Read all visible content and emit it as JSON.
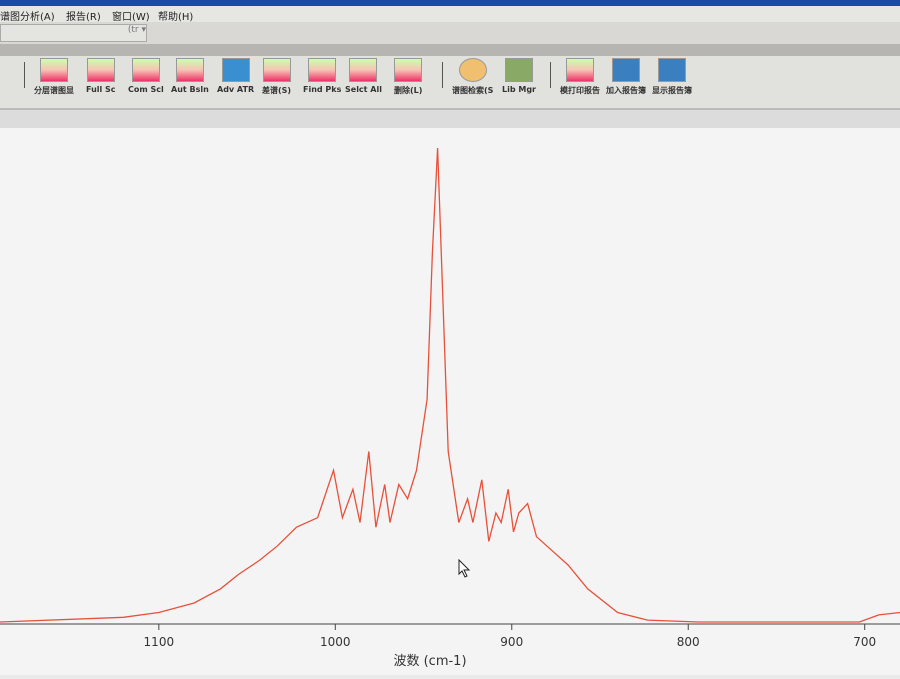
{
  "menu": [
    "谱图分析(A)",
    "报告(R)",
    "窗口(W)",
    "帮助(H)"
  ],
  "combo_value": "(tr",
  "toolbar": [
    "分层谱图显",
    "Full Sc",
    "Com Scl",
    "Aut Bsln",
    "Adv ATR",
    "差谱(S)",
    "Find Pks",
    "Selct All",
    "删除(L)",
    "谱图检索(S",
    "Lib Mgr",
    "模打印报告",
    "加入报告簿",
    "显示报告簿"
  ],
  "chart_data": {
    "type": "line",
    "title": "",
    "xlabel": "波数 (cm-1)",
    "ylabel": "",
    "xlim": [
      1190,
      680
    ],
    "x_reversed": true,
    "ylim": [
      0,
      1
    ],
    "xticks": [
      "1100",
      "1000",
      "900",
      "800",
      "700"
    ],
    "grid": false,
    "line_color": "#e8503a",
    "x": [
      1190,
      1120,
      1100,
      1080,
      1065,
      1055,
      1043,
      1033,
      1022,
      1010,
      1001,
      996,
      990,
      986,
      981,
      977,
      972,
      969,
      964,
      959,
      954,
      948,
      945,
      942,
      939,
      936,
      930,
      925,
      922,
      917,
      913,
      909,
      906,
      902,
      899,
      896,
      891,
      886,
      880,
      868,
      857,
      840,
      823,
      794,
      703,
      692,
      680
    ],
    "y": [
      0,
      0.01,
      0.02,
      0.04,
      0.07,
      0.1,
      0.13,
      0.16,
      0.2,
      0.22,
      0.32,
      0.22,
      0.28,
      0.21,
      0.36,
      0.2,
      0.29,
      0.21,
      0.29,
      0.26,
      0.32,
      0.47,
      0.78,
      1.0,
      0.68,
      0.36,
      0.21,
      0.26,
      0.21,
      0.3,
      0.17,
      0.23,
      0.21,
      0.28,
      0.19,
      0.23,
      0.25,
      0.18,
      0.16,
      0.12,
      0.07,
      0.02,
      0.004,
      0,
      0,
      0.015,
      0.02
    ]
  }
}
